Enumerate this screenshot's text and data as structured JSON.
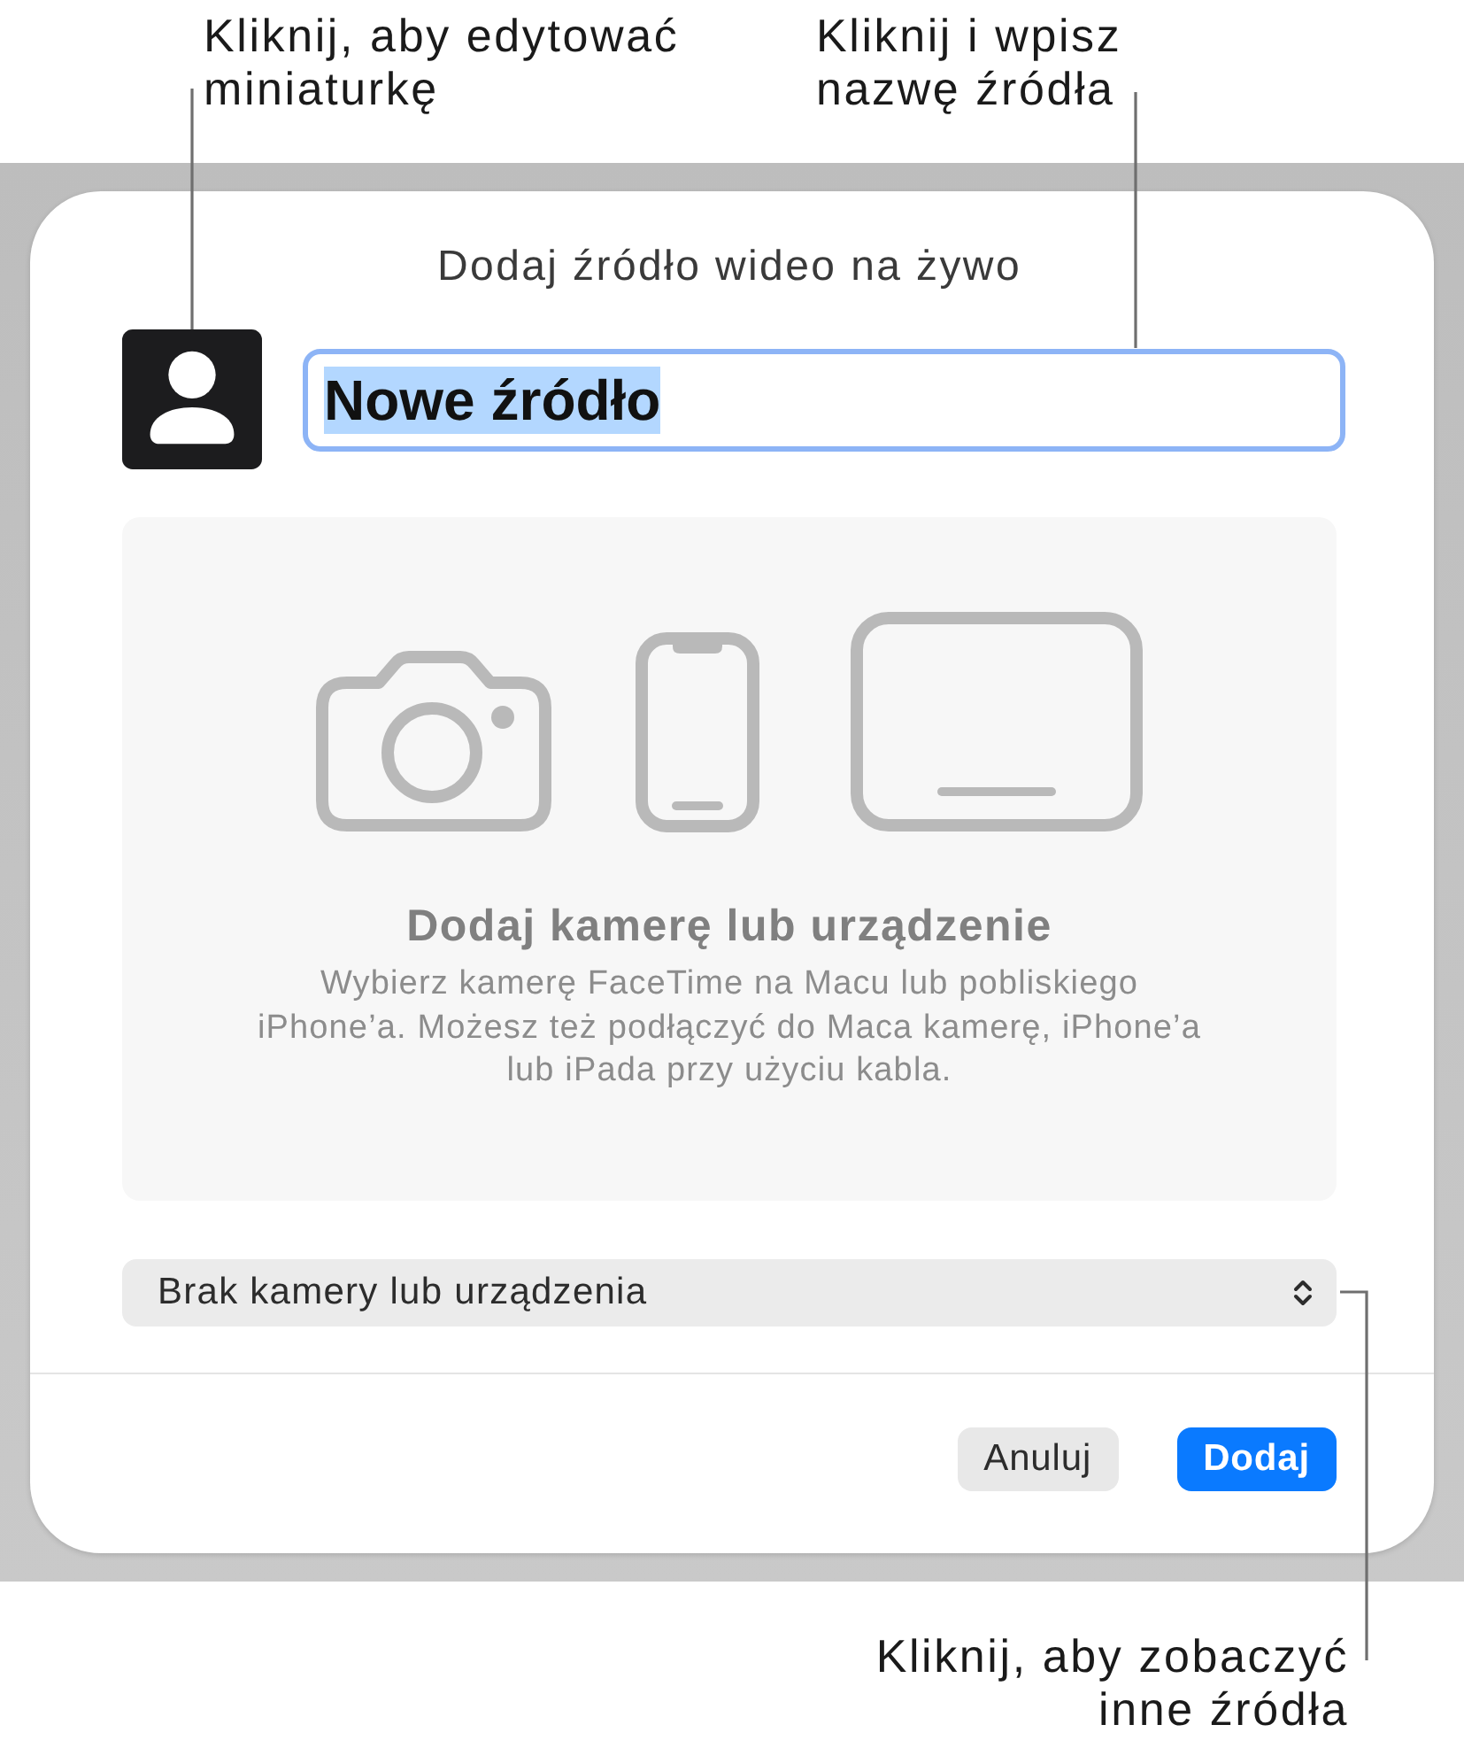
{
  "annotations": [
    {
      "kind": "thumbnail",
      "text": "Kliknij, aby edytować miniaturkę"
    },
    {
      "kind": "name",
      "text": "Kliknij i wpisz nazwę źródła"
    },
    {
      "kind": "source",
      "text": "Kliknij, aby zobaczyć inne źródła"
    }
  ],
  "dialog": {
    "title": "Dodaj źródło wideo na żywo",
    "name_field": {
      "value": "Nowe źródło",
      "text_selected": true,
      "focused": true
    },
    "devices_panel": {
      "heading": "Dodaj kamerę lub urządzenie",
      "description": "Wybierz kamerę FaceTime na Macu lub pobliskiego iPhone’a. Możesz też podłączyć do Maca kamerę, iPhone’a lub iPada przy użyciu kabla."
    },
    "source_popup": {
      "value": "Brak kamery lub urządzenia"
    },
    "buttons": [
      {
        "label": "Anuluj",
        "kind": "secondary"
      },
      {
        "label": "Dodaj",
        "kind": "primary"
      }
    ]
  }
}
